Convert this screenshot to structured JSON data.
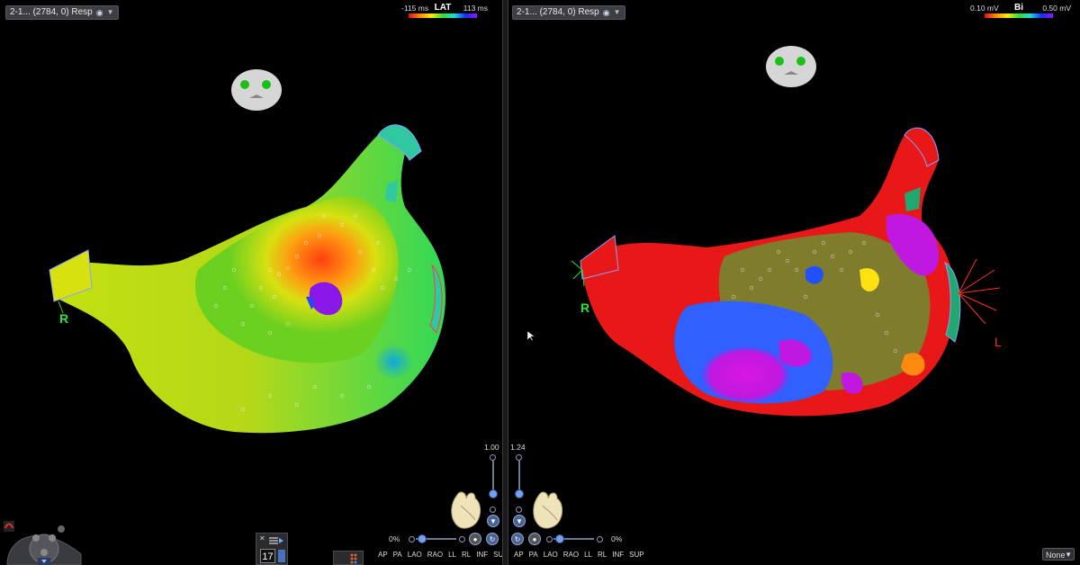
{
  "left": {
    "map_label": "2-1... (2784, 0) Resp",
    "scale": {
      "min": "-115 ms",
      "title": "LAT",
      "max": "113 ms"
    },
    "orient_right": "R",
    "zoom": "1.00",
    "opacity": "0%"
  },
  "right": {
    "map_label": "2-1... (2784, 0) Resp",
    "scale": {
      "min": "0.10 mV",
      "title": "Bi",
      "max": "0.50 mV"
    },
    "orient_right": "R",
    "orient_left": "L",
    "zoom": "1.24",
    "opacity": "0%"
  },
  "views": [
    "AP",
    "PA",
    "LAO",
    "RAO",
    "LL",
    "RL",
    "INF",
    "SUP"
  ],
  "count_value": "17",
  "none_select": "None",
  "icons": {
    "camera": "camera-icon",
    "chevron": "chevron-down-icon",
    "head": "patient-head-icon",
    "heart": "heart-model-icon"
  },
  "colors": {
    "accent": "#7aa0e8",
    "orient_green": "#2ee040",
    "orient_red": "#ff3020"
  }
}
